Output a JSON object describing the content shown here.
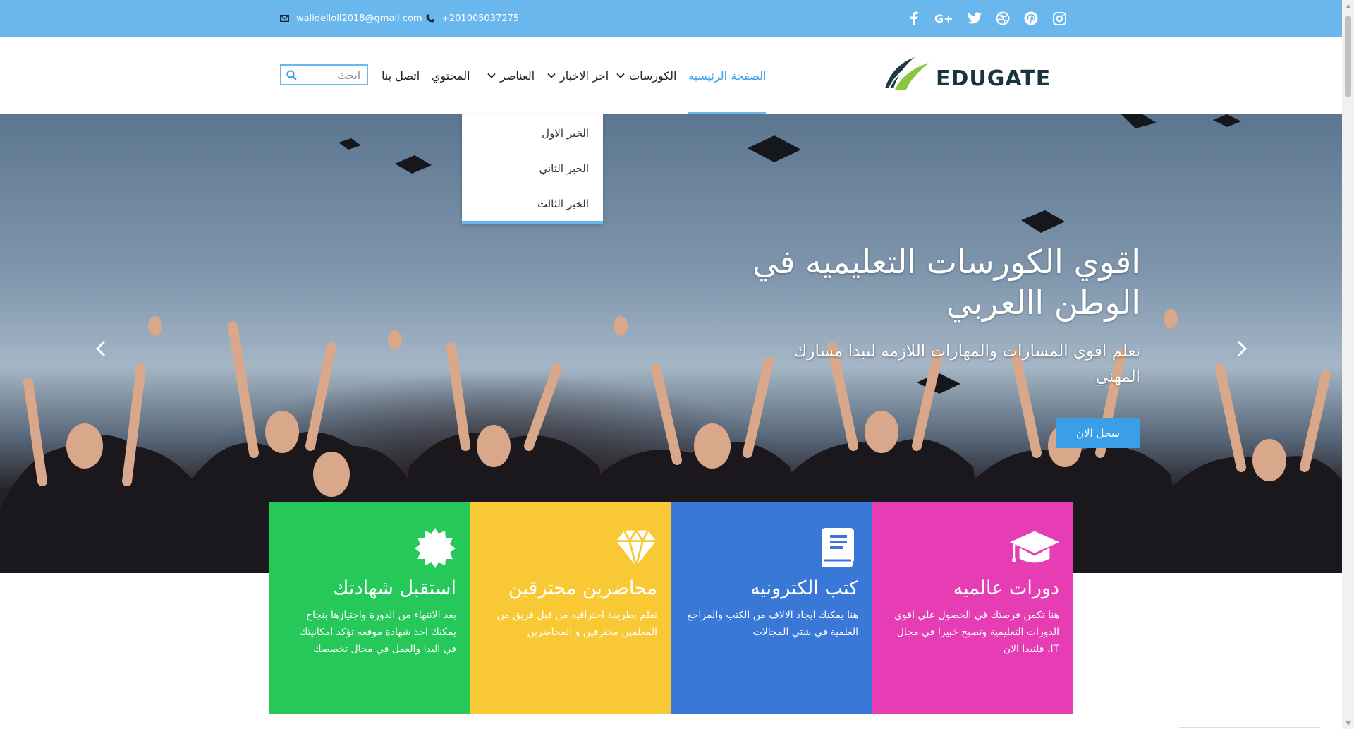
{
  "topbar": {
    "email": "walidelloll2018@gmail.com",
    "phone": "+201005037275",
    "socials": [
      "facebook-icon",
      "google-plus-icon",
      "twitter-icon",
      "dribbble-icon",
      "pinterest-icon",
      "instagram-icon"
    ]
  },
  "header": {
    "logo_text": "EDUGATE",
    "search_placeholder": "ابحث",
    "nav": {
      "home": "الصفحة الرئيسيه",
      "courses": "الكورسات",
      "news": "اخر الاخبار",
      "elements": "العناصر",
      "content": "المحتوي",
      "contact": "اتصل بنا"
    }
  },
  "dropdown": {
    "items": [
      "الخبر الاول",
      "الخبر الثاني",
      "الخبر الثالث"
    ]
  },
  "hero": {
    "title": "اقوي الكورسات التعليميه في الوطن االعربي",
    "subtitle": "تعلم اقوي المسارات والمهارات اللازمه لتبدا مسارك المهني",
    "button": "سجل الان"
  },
  "features": [
    {
      "title": "دورات عالميه",
      "text": "هنا تكمن فرصتك في الحصول علي اقوي الدورات التعليمية وتصبح خبيرا في مجال IT، فلنبدا الان",
      "color": "#e63cb4",
      "icon": "graduation-cap-icon"
    },
    {
      "title": "كتب الكترونيه",
      "text": "هنا يمكنك ايجاد الالاف من الكتب والمراجع العلمية في شتي المجالات",
      "color": "#3a78d8",
      "icon": "book-icon"
    },
    {
      "title": "محاضرين محترقين",
      "text": "تعلم بطريقة احترافيه من قبل فريق من المعلمين محترفين و المحاضرين",
      "color": "#f8c935",
      "icon": "diamond-icon"
    },
    {
      "title": "استقبل شهادتك",
      "text": "بعد الانتهاء من الدورة واجتيازها بنجاح يمكنك اخذ شهادة موقعه تؤكد امكانيتك في البدا والعمل في مجال تخصصك",
      "color": "#27c85a",
      "icon": "certificate-icon"
    }
  ],
  "colors": {
    "accent": "#6ab7ee",
    "link_active": "#3a9fe6"
  }
}
